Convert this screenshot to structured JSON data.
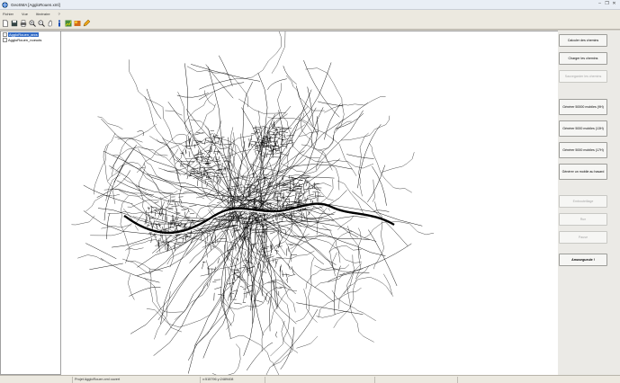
{
  "window": {
    "title": "GeoSMA [AggloRouen.xml]",
    "controls": [
      "–",
      "❐",
      "✕"
    ]
  },
  "menu": {
    "items": [
      "Fichier",
      "Vue",
      "Itinéraire",
      "?"
    ]
  },
  "toolbar": {
    "buttons": [
      "new-icon",
      "save-icon",
      "print-icon",
      "zoom-in-icon",
      "zoom-out-icon",
      "pan-icon",
      "info-icon",
      "route-icon",
      "layers-icon",
      "pencil-icon"
    ]
  },
  "tree": {
    "items": [
      {
        "label": "AggloRouen_arcs",
        "selected": true
      },
      {
        "label": "AggloRouen_noeuds",
        "selected": false
      }
    ]
  },
  "panel": {
    "buttons": [
      {
        "label": "Calculer des chemins",
        "enabled": true
      },
      {
        "label": "Charger les chemins",
        "enabled": true
      },
      {
        "label": "Sauvegarder les chemins",
        "enabled": false
      },
      {
        "label": "Générer 50000 mobiles (9H)",
        "enabled": true
      },
      {
        "label": "Générer 5000 mobiles (13H)",
        "enabled": true
      },
      {
        "label": "Générer 5000 mobiles (17H)",
        "enabled": true
      },
      {
        "label": "Générer un mobile au hasard",
        "enabled": true
      },
      {
        "label": "Embouteillage",
        "enabled": false
      },
      {
        "label": "Run",
        "enabled": false
      },
      {
        "label": "Pause",
        "enabled": false
      },
      {
        "label": "Amusegueule !",
        "enabled": true
      }
    ]
  },
  "status": {
    "message": "Projet AggloRouen.xml ouvert",
    "coords": "x:515796 y:2489408"
  }
}
